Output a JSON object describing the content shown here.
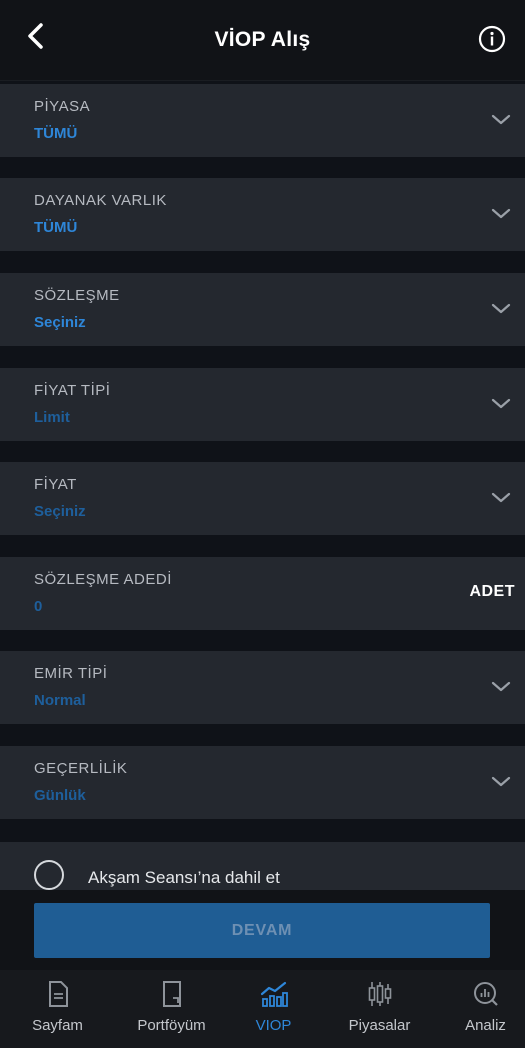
{
  "header": {
    "title": "VİOP Alış"
  },
  "fields": [
    {
      "label": "PİYASA",
      "value": "TÜMÜ"
    },
    {
      "label": "DAYANAK VARLIK",
      "value": "TÜMÜ"
    },
    {
      "label": "SÖZLEŞME",
      "value": "Seçiniz"
    },
    {
      "label": "FİYAT TİPİ",
      "value": "Limit"
    },
    {
      "label": "FİYAT",
      "value": "Seçiniz"
    },
    {
      "label": "SÖZLEŞME ADEDİ",
      "value": "0",
      "unit": "ADET"
    },
    {
      "label": "EMİR TİPİ",
      "value": "Normal"
    },
    {
      "label": "GEÇERLİLİK",
      "value": "Günlük"
    }
  ],
  "evening_session": {
    "label": "Akşam Seansı’na dahil et",
    "checked": false
  },
  "continue_button": {
    "label": "DEVAM"
  },
  "tabs": [
    {
      "label": "Sayfam",
      "icon": "document-icon"
    },
    {
      "label": "Portföyüm",
      "icon": "portfolio-icon"
    },
    {
      "label": "VIOP",
      "icon": "viop-chart-icon",
      "active": true
    },
    {
      "label": "Piyasalar",
      "icon": "candlestick-icon"
    },
    {
      "label": "Analiz",
      "icon": "analysis-icon"
    }
  ],
  "colors": {
    "accent": "#2e86d8",
    "row_bg": "#24282f",
    "page_bg": "#0f1218",
    "button_bg": "#1f5d94"
  }
}
